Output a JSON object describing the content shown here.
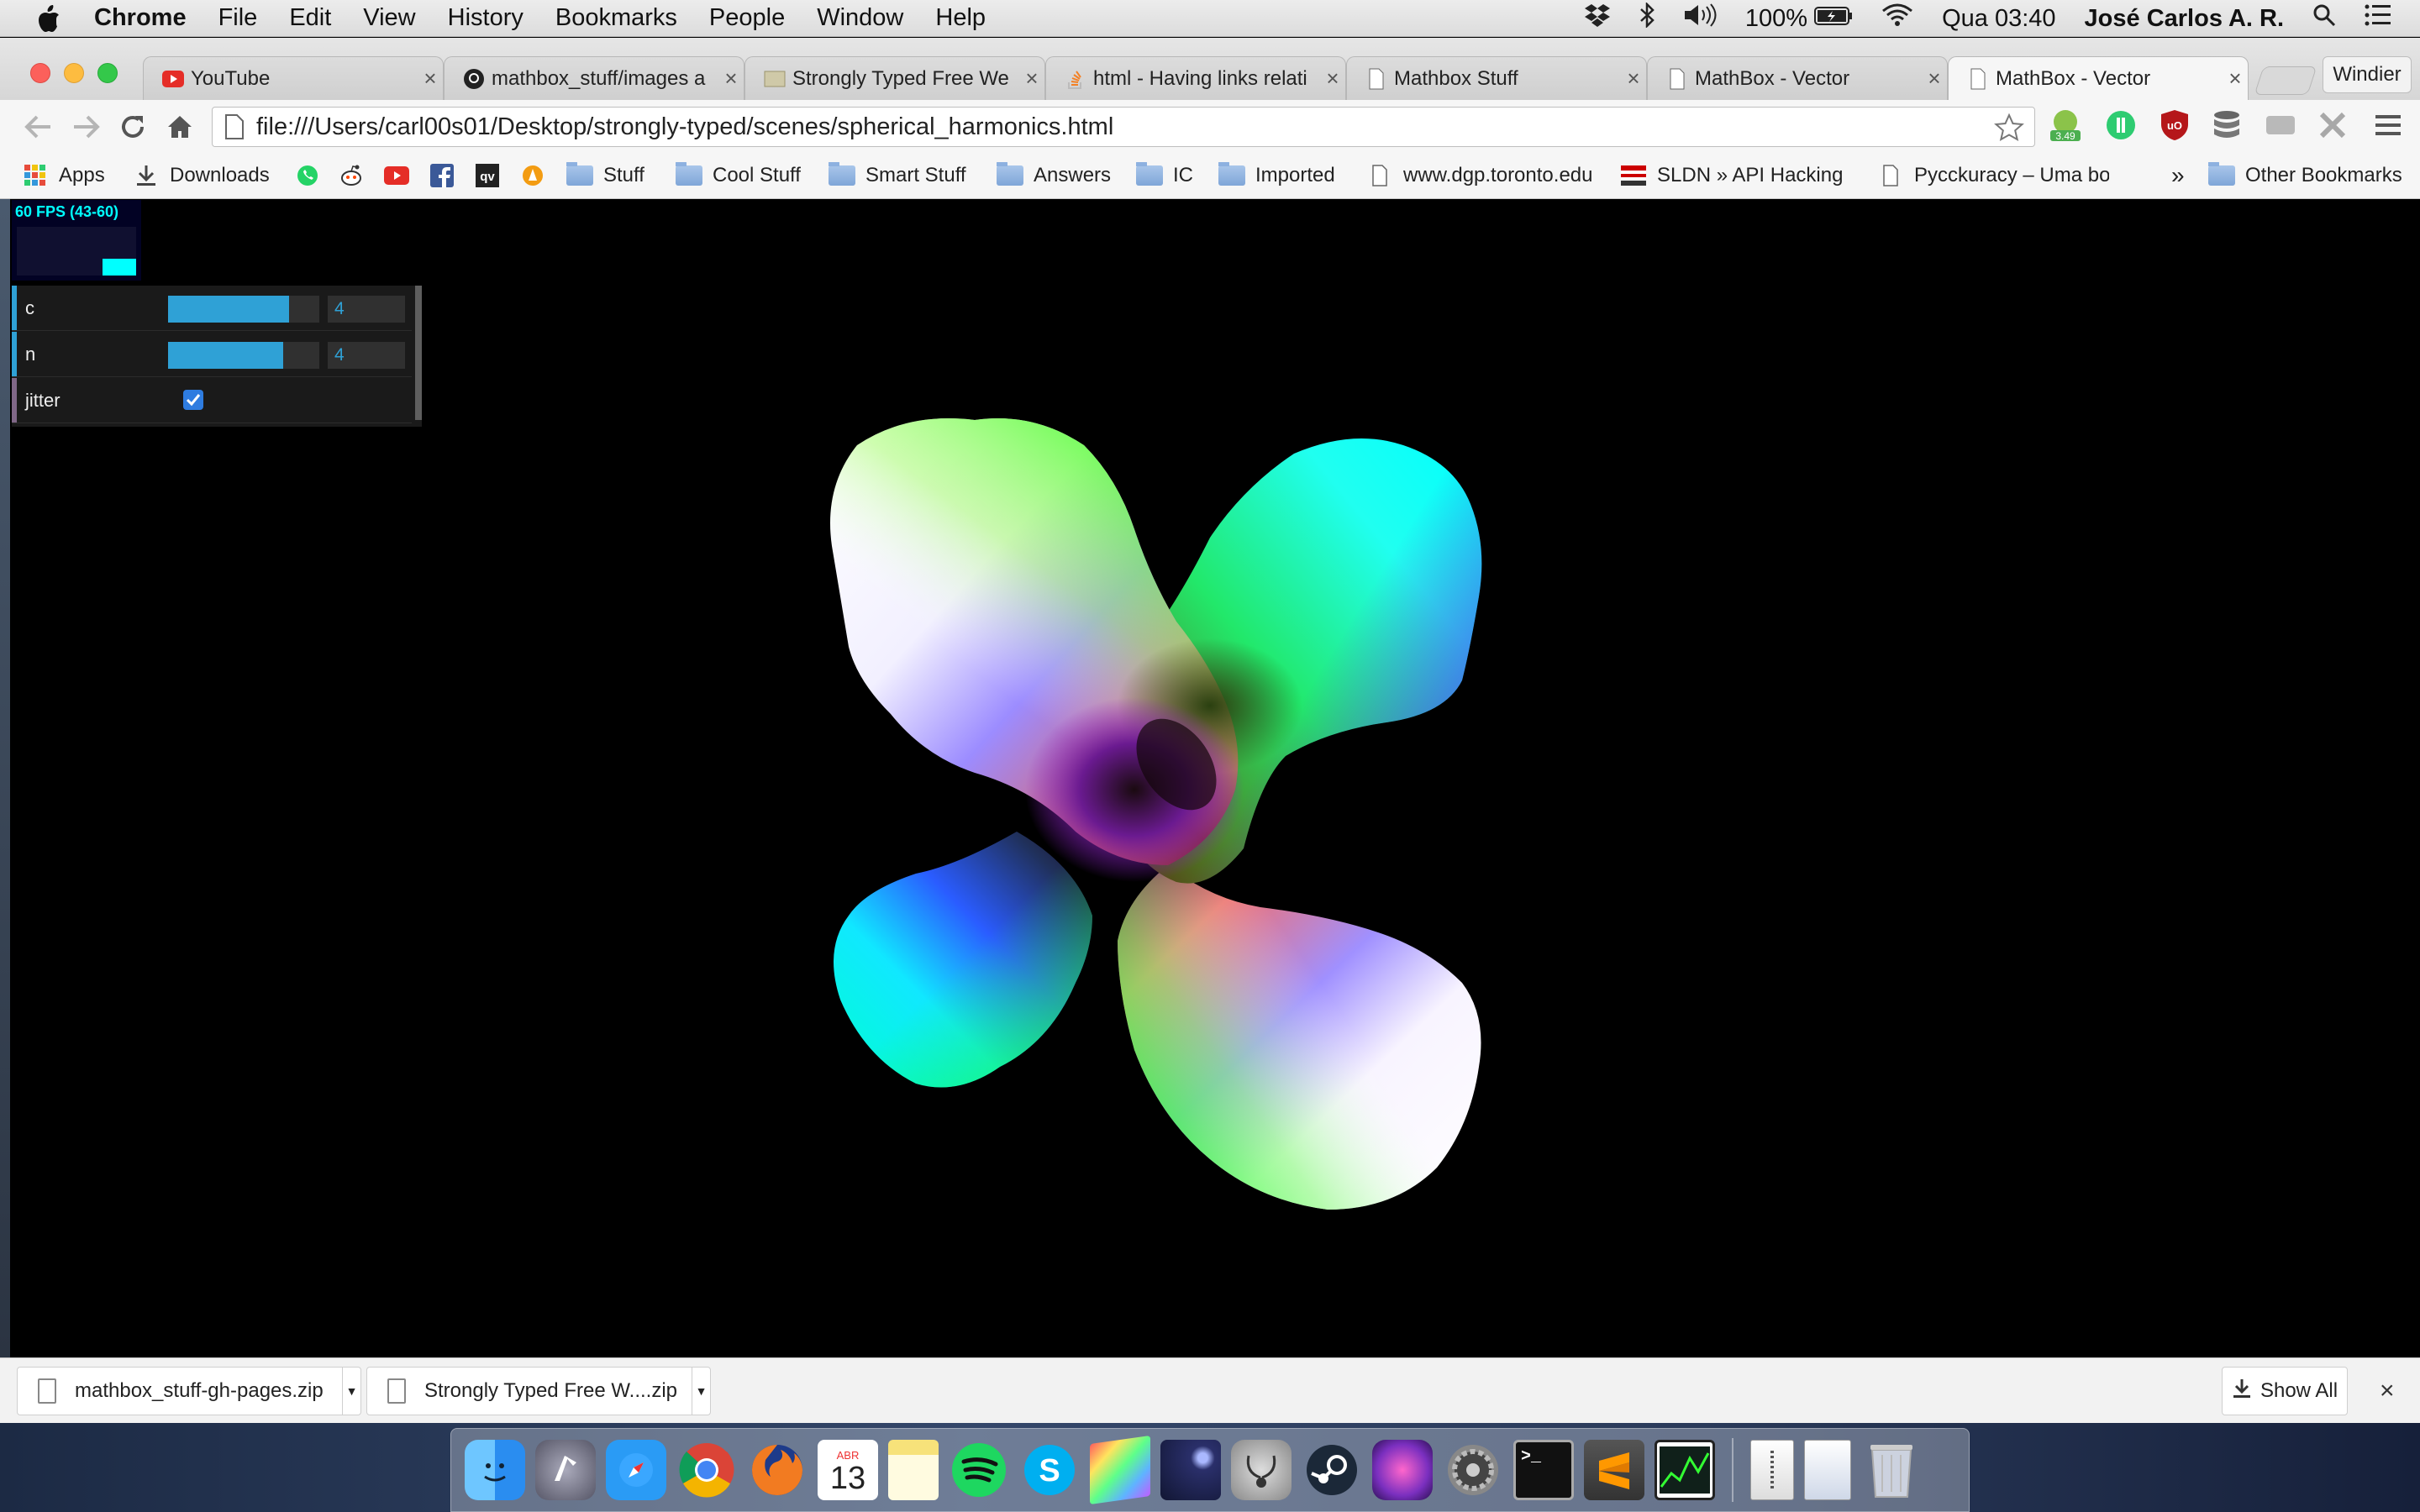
{
  "menubar": {
    "app_name": "Chrome",
    "items": [
      "File",
      "Edit",
      "View",
      "History",
      "Bookmarks",
      "People",
      "Window",
      "Help"
    ],
    "battery": "100%",
    "clock": "Qua 03:40",
    "user": "José Carlos A. R."
  },
  "tabs": [
    {
      "title": "YouTube",
      "icon": "youtube-icon",
      "active": false
    },
    {
      "title": "mathbox_stuff/images a",
      "icon": "github-icon",
      "active": false
    },
    {
      "title": "Strongly Typed Free We",
      "icon": "page-icon",
      "active": false
    },
    {
      "title": "html - Having links relati",
      "icon": "stackoverflow-icon",
      "active": false
    },
    {
      "title": "Mathbox Stuff",
      "icon": "page-icon",
      "active": false
    },
    {
      "title": "MathBox - Vector",
      "icon": "page-icon",
      "active": false
    },
    {
      "title": "MathBox - Vector",
      "icon": "page-icon",
      "active": true
    }
  ],
  "profile_button": "Windier",
  "address_bar": {
    "url": "file:///Users/carl00s01/Desktop/strongly-typed/scenes/spherical_harmonics.html"
  },
  "extension_badge": "3.49",
  "bookmarks": [
    {
      "label": "Apps",
      "icon": "apps-grid-icon"
    },
    {
      "label": "Downloads",
      "icon": "download-icon"
    },
    {
      "label": "",
      "icon": "whatsapp-icon"
    },
    {
      "label": "",
      "icon": "reddit-icon"
    },
    {
      "label": "",
      "icon": "youtube-icon"
    },
    {
      "label": "",
      "icon": "facebook-icon"
    },
    {
      "label": "",
      "icon": "qv-icon"
    },
    {
      "label": "",
      "icon": "orange-icon"
    },
    {
      "label": "Stuff",
      "icon": "folder-icon"
    },
    {
      "label": "Cool Stuff",
      "icon": "folder-icon"
    },
    {
      "label": "Smart Stuff",
      "icon": "folder-icon"
    },
    {
      "label": "Answers",
      "icon": "folder-icon"
    },
    {
      "label": "IC",
      "icon": "folder-icon"
    },
    {
      "label": "Imported",
      "icon": "folder-icon"
    },
    {
      "label": "www.dgp.toronto.edu",
      "icon": "page-icon"
    },
    {
      "label": "SLDN » API Hacking",
      "icon": "flag-icon"
    },
    {
      "label": "Pycckuracy – Uma boa",
      "icon": "page-icon"
    }
  ],
  "bookmarks_overflow": "»",
  "other_bookmarks": "Other Bookmarks",
  "stats": {
    "fps_label": "60 FPS (43-60)",
    "fps_level": 0.35
  },
  "gui": {
    "controls": [
      {
        "name": "c",
        "value": "4",
        "fill": 0.8
      },
      {
        "name": "n",
        "value": "4",
        "fill": 0.76
      },
      {
        "name": "jitter",
        "checked": true
      }
    ]
  },
  "downloads": {
    "items": [
      "mathbox_stuff-gh-pages.zip",
      "Strongly Typed Free W....zip"
    ],
    "show_all": "Show All"
  },
  "dock": {
    "calendar_month": "ABR",
    "calendar_day": "13"
  }
}
